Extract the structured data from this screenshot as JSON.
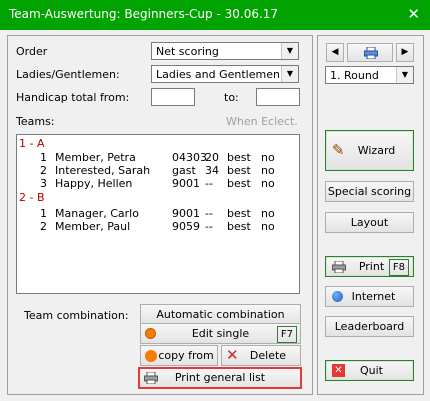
{
  "window": {
    "title": "Team-Auswertung: Beginners-Cup - 30.06.17",
    "close_glyph": "✕"
  },
  "form": {
    "order_label": "Order",
    "order_value": "Net scoring",
    "gender_label": "Ladies/Gentlemen:",
    "gender_value": "Ladies and Gentlemen",
    "handicap_label": "Handicap total from:",
    "handicap_from": "",
    "to_label": "to:",
    "handicap_to": "",
    "teams_label": "Teams:",
    "when_eclect_label": "When Eclect."
  },
  "teams": [
    {
      "name": "1 - A",
      "members": [
        {
          "no": "1",
          "name": "Member, Petra",
          "id": "04303",
          "hcp": "20",
          "score": "best",
          "flag": "no"
        },
        {
          "no": "2",
          "name": "Interested, Sarah",
          "id": "gast",
          "hcp": "34",
          "score": "best",
          "flag": "no"
        },
        {
          "no": "3",
          "name": "Happy, Hellen",
          "id": "9001",
          "hcp": "--",
          "score": "best",
          "flag": "no"
        }
      ]
    },
    {
      "name": "2 - B",
      "members": [
        {
          "no": "1",
          "name": "Manager, Carlo",
          "id": "9001",
          "hcp": "--",
          "score": "best",
          "flag": "no"
        },
        {
          "no": "2",
          "name": "Member, Paul",
          "id": "9059",
          "hcp": "--",
          "score": "best",
          "flag": "no"
        }
      ]
    }
  ],
  "bottom": {
    "team_combination_label": "Team combination:",
    "automatic_combination": "Automatic combination",
    "edit_single": "Edit single",
    "edit_key": "F7",
    "copy_from": "copy from",
    "delete": "Delete",
    "print_general_list": "Print general list"
  },
  "right": {
    "round_value": "1. Round",
    "wizard": "Wizard",
    "special_scoring": "Special scoring",
    "layout": "Layout",
    "print": "Print",
    "print_key": "F8",
    "internet": "Internet",
    "leaderboard": "Leaderboard",
    "quit": "Quit"
  },
  "colors": {
    "titlebar": "#00a300",
    "group_label": "#b00000",
    "highlight": "#e53935"
  }
}
